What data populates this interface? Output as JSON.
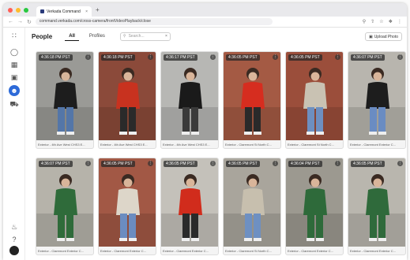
{
  "browser": {
    "tab_title": "Verkada Command",
    "tab_close": "×",
    "new_tab": "+",
    "url": "command.verkada.com/cross-camera/frontVideoPlayback/close",
    "colors": {
      "close": "#ff5f57",
      "min": "#febc2e",
      "max": "#28c840"
    }
  },
  "page": {
    "title": "People",
    "tabs": [
      {
        "label": "All"
      },
      {
        "label": "Profiles"
      }
    ],
    "search_placeholder": "Search...",
    "search_clear": "×",
    "upload_label": "Upload Photo",
    "accent": "#2d6ad8"
  },
  "cards": [
    {
      "time": "4:36:18 PM PST",
      "caption": "Exterior - 4th Ave West CHS3 E...",
      "shirt": "#1d1d1d",
      "pants": "#5476a8",
      "bg": "#9a9a96"
    },
    {
      "time": "4:36:18 PM PST",
      "caption": "Exterior - 4th Ave West CHS3 E...",
      "shirt": "#c8321f",
      "pants": "#2a2a2a",
      "bg": "#8b4a3a"
    },
    {
      "time": "4:36:17 PM PST",
      "caption": "Exterior - 4th Ave West CHS3 E...",
      "shirt": "#1a1a1a",
      "pants": "#3a3a3a",
      "bg": "#b7b7b4"
    },
    {
      "time": "4:36:05 PM PST",
      "caption": "Exterior - Claremont St North C...",
      "shirt": "#d62d1f",
      "pants": "#2a2a2a",
      "bg": "#a45a44"
    },
    {
      "time": "4:36:05 PM PST",
      "caption": "Exterior - Claremont St North C...",
      "shirt": "#c9c2b3",
      "pants": "#6d8fc0",
      "bg": "#9b4e3b"
    },
    {
      "time": "4:36:07 PM PST",
      "caption": "Exterior - Claremont Exterior C...",
      "shirt": "#1d1d1d",
      "pants": "#6a8cc2",
      "bg": "#b8b5ae"
    },
    {
      "time": "4:36:07 PM PST",
      "caption": "Exterior - Claremont Exterior C...",
      "shirt": "#2f6b3a",
      "pants": "#2f6b3a",
      "bg": "#b6b3aa"
    },
    {
      "time": "4:36:05 PM PST",
      "caption": "Exterior - Claremont Exterior C...",
      "shirt": "#ddd6c9",
      "pants": "#6b8cc0",
      "bg": "#a25845"
    },
    {
      "time": "4:36:05 PM PST",
      "caption": "Exterior - Claremont Exterior C...",
      "shirt": "#d12c1c",
      "pants": "#2a2a2a",
      "bg": "#c4c1ba"
    },
    {
      "time": "4:36:05 PM PST",
      "caption": "Exterior - Claremont St North C...",
      "shirt": "#c7bfae",
      "pants": "#6e90c2",
      "bg": "#a9a59c"
    },
    {
      "time": "4:36:04 PM PST",
      "caption": "Exterior - Claremont Exterior C...",
      "shirt": "#2e6a3a",
      "pants": "#2e6a3a",
      "bg": "#9c9990"
    },
    {
      "time": "4:36:05 PM PST",
      "caption": "Exterior - Claremont Exterior C...",
      "shirt": "#2f6a3b",
      "pants": "#2f6a3b",
      "bg": "#b9b6ae"
    }
  ]
}
